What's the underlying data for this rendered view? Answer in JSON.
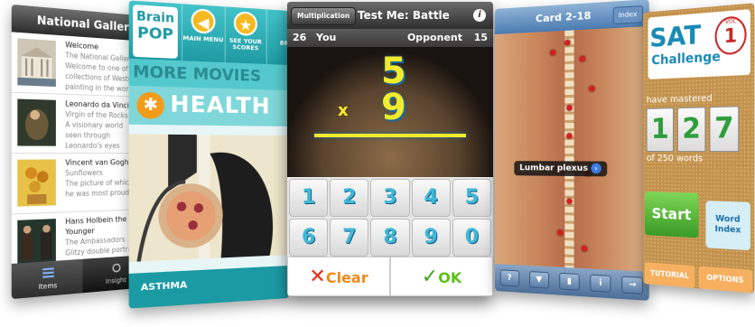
{
  "gallery": {
    "title": "National Gallery, L",
    "items": [
      {
        "title": "Welcome",
        "line1": "The National Gallery,",
        "line2": "Welcome to one of the",
        "line3": "collections of Western",
        "line4": "painting in the world"
      },
      {
        "title": "Leonardo da Vinci",
        "line1": "Virgin of the Rocks",
        "line2": "A visionary world",
        "line3": "seen through",
        "line4": "Leonardo's eyes"
      },
      {
        "title": "Vincent van Gogh",
        "line1": "Sunflowers",
        "line2": "The picture of which",
        "line3": "he was most proud",
        "line4": ""
      },
      {
        "title": "Hans Holbein the Younger",
        "line1": "The Ambassadors",
        "line2": "Glitzy double portrait",
        "line3": "",
        "line4": ""
      }
    ],
    "tabs": {
      "items": "Items",
      "insight": "Insight"
    }
  },
  "brainpop": {
    "logo_line1": "Brain",
    "logo_line2": "POP",
    "main_menu": "MAIN MENU",
    "see_scores": "SEE YOUR SCORES",
    "extra": "BRA",
    "more_movies": "MORE MOVIES",
    "category": "HEALTH",
    "movie": "ASTHMA"
  },
  "battle": {
    "mult_button": "Multiplication",
    "title": "Test Me: Battle",
    "info": "i",
    "you_score": "26",
    "you_label": "You",
    "opp_label": "Opponent",
    "opp_score": "15",
    "top_number": "5",
    "operator": "x",
    "bottom_number": "9",
    "keys": [
      "1",
      "2",
      "3",
      "4",
      "5",
      "6",
      "7",
      "8",
      "9",
      "0"
    ],
    "clear": "Clear",
    "ok": "OK"
  },
  "anatomy": {
    "title": "Card 2-18",
    "index": "Index",
    "label": "Lumbar plexus",
    "tools": [
      "?",
      "",
      "",
      "i",
      "→"
    ]
  },
  "sat": {
    "sat": "SAT",
    "challenge": "Challenge",
    "vol_label": "VOL",
    "vol_num": "1",
    "mastered": "have mastered",
    "digits": [
      "1",
      "2",
      "7"
    ],
    "of_words": "of 250 words",
    "start": "Start",
    "word_index": "Word Index",
    "tutorial": "TUTORIAL",
    "options": "OPTIONS"
  }
}
